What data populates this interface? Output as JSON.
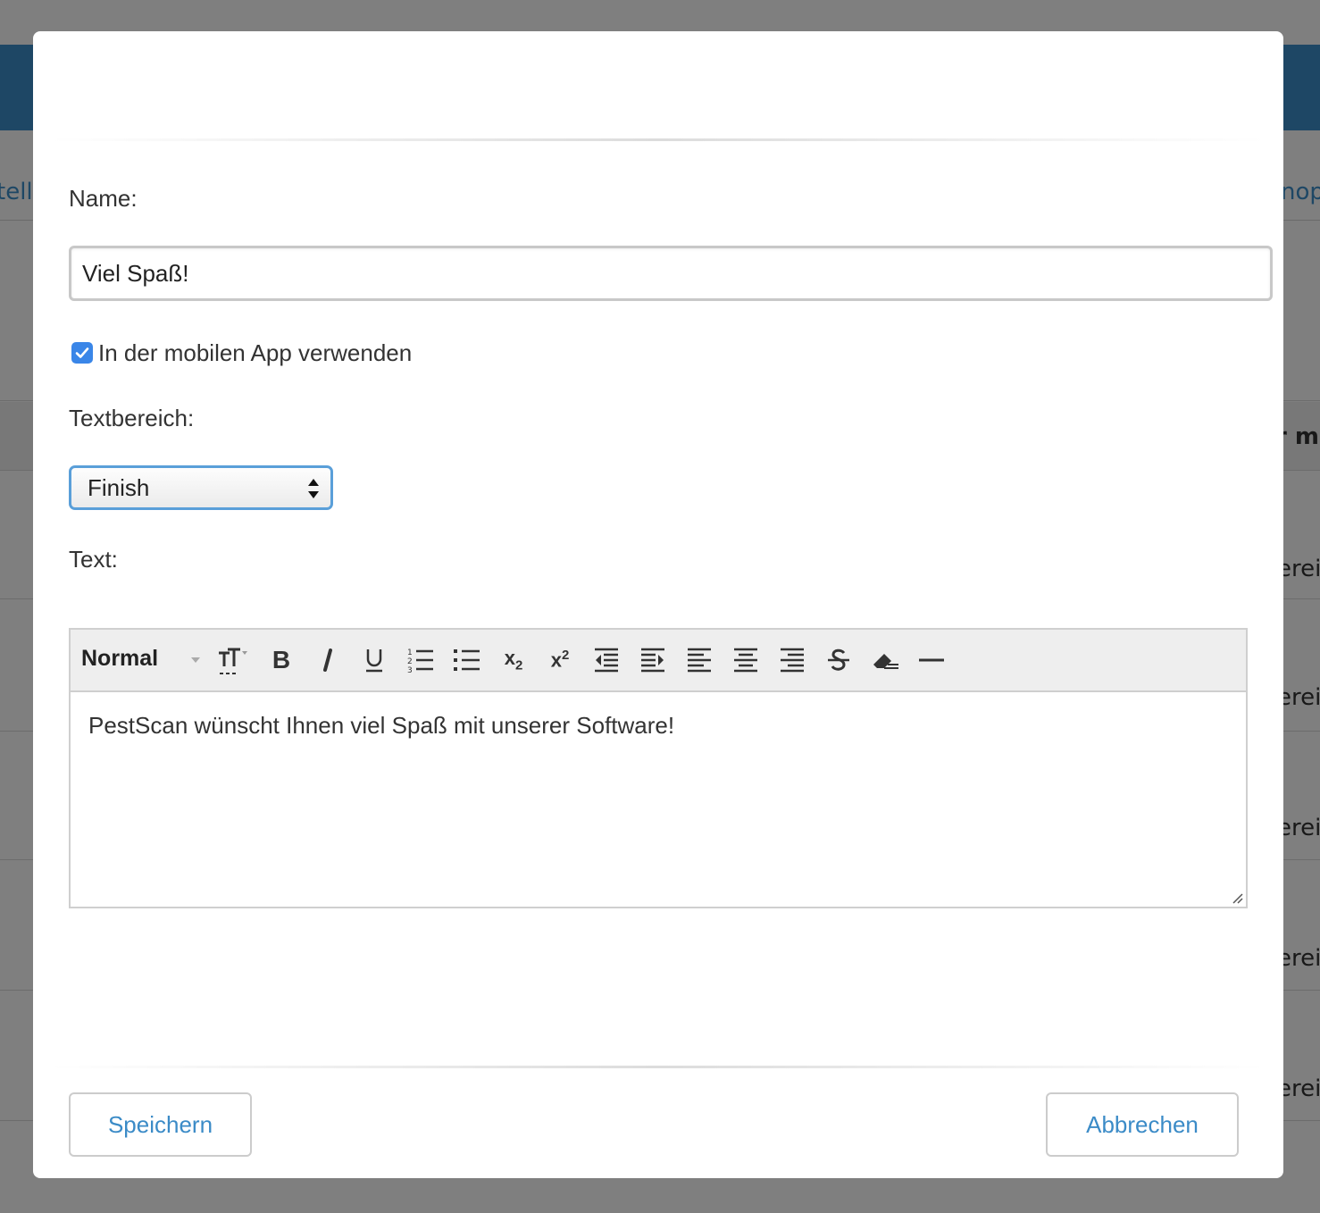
{
  "background": {
    "nav_left_fragment": "tellu",
    "nav_right_fragment": "nop",
    "table_header_fragment": "r mo",
    "row_fragments": [
      "ereic",
      "ereic",
      "ereic",
      "ereic",
      "ereic"
    ]
  },
  "dialog": {
    "name_label": "Name:",
    "name_value": "Viel Spaß!",
    "mobile_checkbox_label": "In der mobilen App verwenden",
    "mobile_checkbox_checked": true,
    "textarea_label": "Textbereich:",
    "textarea_selected": "Finish",
    "text_label": "Text:",
    "editor": {
      "heading_style": "Normal",
      "toolbar_icons": [
        "font-size-icon",
        "bold-icon",
        "italic-icon",
        "underline-icon",
        "ordered-list-icon",
        "unordered-list-icon",
        "subscript-icon",
        "superscript-icon",
        "outdent-icon",
        "indent-icon",
        "align-left-icon",
        "align-center-icon",
        "align-right-icon",
        "strikethrough-icon",
        "eraser-icon",
        "horizontal-rule-icon"
      ],
      "content": "PestScan wünscht Ihnen viel Spaß mit unserer Software!"
    },
    "save_label": "Speichern",
    "cancel_label": "Abbrechen"
  },
  "colors": {
    "accent": "#3b8bc7",
    "checkbox": "#3a86e8",
    "select_focus": "#5a9fd9"
  }
}
